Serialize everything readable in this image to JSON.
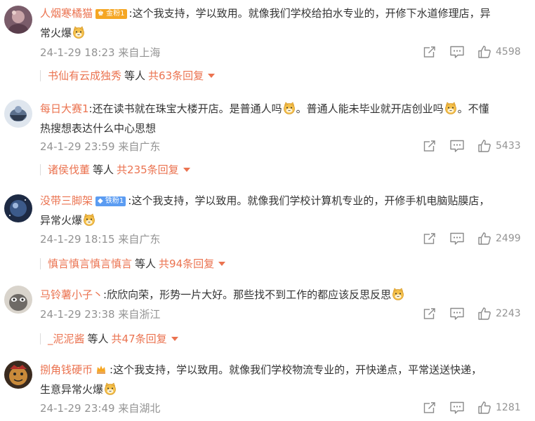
{
  "accent_color": "#eb7350",
  "meta_color": "#939393",
  "comments": [
    {
      "username": "人烟寒橘猫",
      "badge": "金粉1",
      "text_line1": ":这个我支持，学以致用。就像我们学校给拍水专业的，开修下水道修理店，异",
      "text_line2": "常火爆",
      "text_line2_emoji": "doge-cat-icon",
      "date": "24-1-29 18:23",
      "location": "来自上海",
      "likes": "4598",
      "reply_user": "书仙有云成独秀",
      "reply_suffix": "等人",
      "reply_count": "共63条回复"
    },
    {
      "username": "每日大赛1",
      "text_line1": ":还在读书就在珠宝大楼开店。是普通人吗",
      "text_line1b": "。普通人能未毕业就开店创业吗",
      "text_line1c": "。不懂",
      "text_line2": "热搜想表达什么中心思想",
      "date": "24-1-29 23:59",
      "location": "来自广东",
      "likes": "5433",
      "reply_user": "诸侯伐董",
      "reply_suffix": "等人",
      "reply_count": "共235条回复"
    },
    {
      "username": "没带三脚架",
      "badge": "铁粉1",
      "text_line1": ":这个我支持，学以致用。就像我们学校计算机专业的，开修手机电脑贴膜店，",
      "text_line2": "异常火爆",
      "date": "24-1-29 18:15",
      "location": "来自广东",
      "likes": "2499",
      "reply_user": "慎言慎言慎言慎言",
      "reply_suffix": "等人",
      "reply_count": "共94条回复"
    },
    {
      "username": "马铃薯小子丶",
      "text_line1": ":欣欣向荣，形势一片大好。那些找不到工作的都应该反思反思",
      "date": "24-1-29 23:38",
      "location": "来自浙江",
      "likes": "2243",
      "reply_user": "_泥泥酱",
      "reply_suffix": "等人",
      "reply_count": "共47条回复"
    },
    {
      "username": "捌角钱硬币",
      "text_line1": ":这个我支持，学以致用。就像我们学校物流专业的，开快递点，平常送送快递，",
      "text_line2": "生意异常火爆",
      "date": "24-1-29 23:49",
      "location": "来自湖北",
      "likes": "1281"
    }
  ]
}
